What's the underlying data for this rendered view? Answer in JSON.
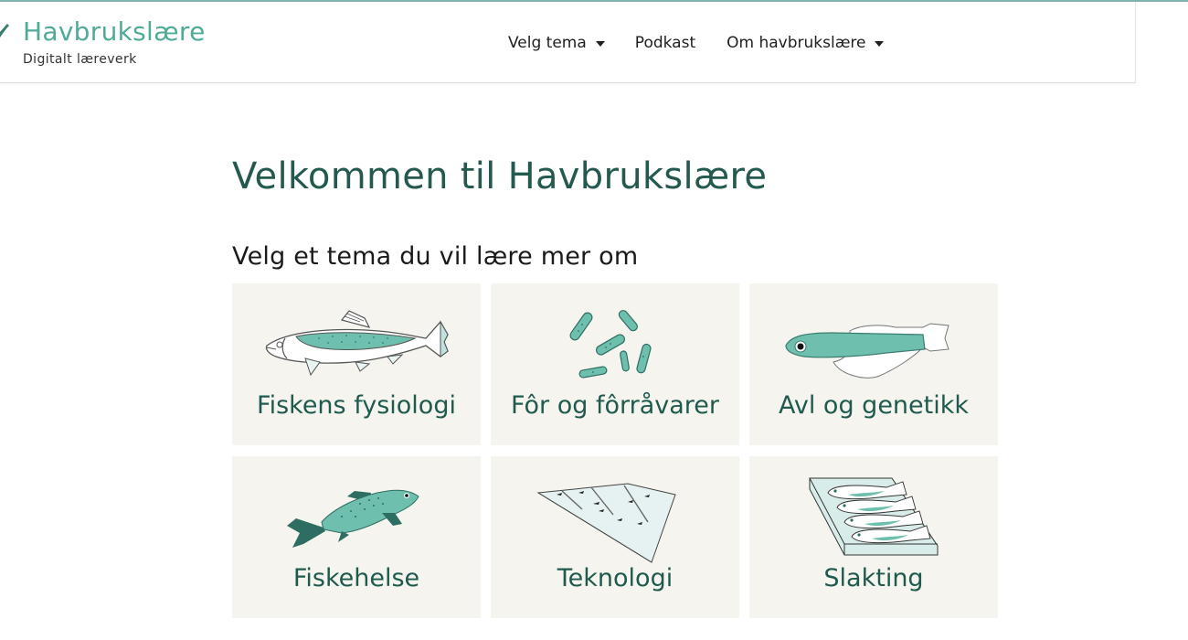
{
  "header": {
    "brand_title": "Havbrukslære",
    "brand_subtitle": "Digitalt læreverk",
    "nav": [
      {
        "label": "Velg tema",
        "has_dropdown": true
      },
      {
        "label": "Podkast",
        "has_dropdown": false
      },
      {
        "label": "Om havbrukslære",
        "has_dropdown": true
      }
    ]
  },
  "main": {
    "title": "Velkommen til Havbrukslære",
    "subtitle": "Velg et tema du vil lære mer om",
    "topics": [
      {
        "label": "Fiskens fysiologi",
        "icon": "salmon-anatomy-icon"
      },
      {
        "label": "Fôr og fôrråvarer",
        "icon": "feed-pellets-icon"
      },
      {
        "label": "Avl og genetikk",
        "icon": "larva-fish-icon"
      },
      {
        "label": "Fiskehelse",
        "icon": "salmon-icon"
      },
      {
        "label": "Teknologi",
        "icon": "fish-tank-icon"
      },
      {
        "label": "Slakting",
        "icon": "fish-box-icon"
      }
    ]
  },
  "colors": {
    "brand": "#4faa98",
    "heading": "#24594f",
    "tile_background": "#f5f4ee",
    "fish_fill": "#6fbfae"
  }
}
